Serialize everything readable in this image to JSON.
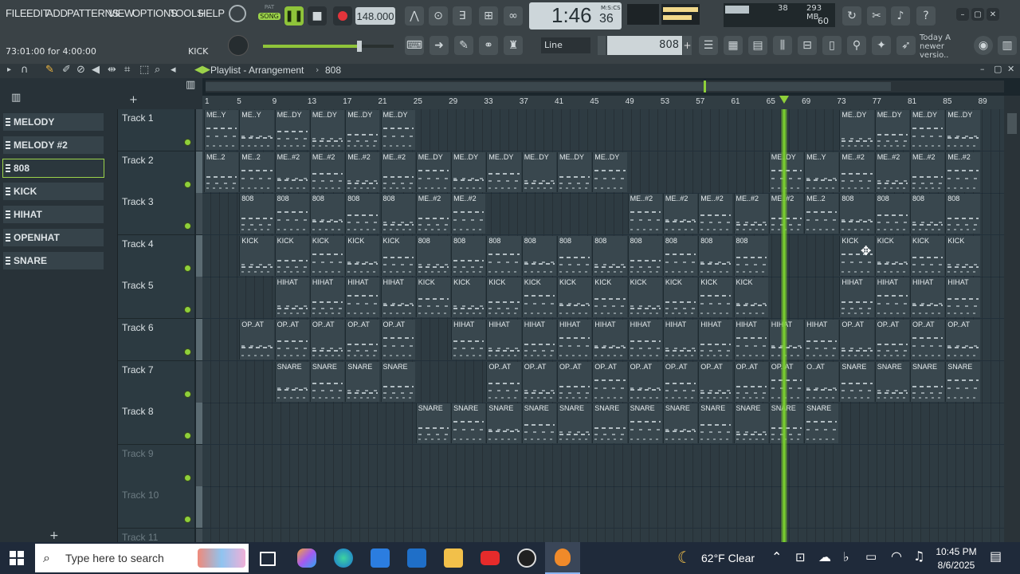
{
  "menu": [
    "FILE",
    "EDIT",
    "ADD",
    "PATTERNS",
    "VIEW",
    "OPTIONS",
    "TOOLS",
    "HELP"
  ],
  "transport": {
    "mode_pat": "PAT",
    "mode_song": "SONG",
    "tempo": "148.000",
    "time_main": "1:46",
    "time_sub": "36",
    "time_label": "M:S:CS"
  },
  "perf": {
    "cpu_num": "38",
    "ram": "293 MB",
    "poly": "60"
  },
  "hint_text": "73:01:00 for 4:00:00",
  "hint_channel": "KICK",
  "snap_mode": "Line",
  "pattern_name": "808",
  "news": {
    "line1": "Today  A",
    "line2": "newer versio.."
  },
  "playlist": {
    "title": "Playlist - Arrangement",
    "current_pattern": "808"
  },
  "patterns": [
    "MELODY",
    "MELODY #2",
    "808",
    "KICK",
    "HIHAT",
    "OPENHAT",
    "SNARE"
  ],
  "selected_pattern_index": 2,
  "tracks": [
    "Track 1",
    "Track 2",
    "Track 3",
    "Track 4",
    "Track 5",
    "Track 6",
    "Track 7",
    "Track 8",
    "Track 9",
    "Track 10",
    "Track 11"
  ],
  "ruler_bars": [
    "1",
    "5",
    "9",
    "13",
    "17",
    "21",
    "25",
    "29",
    "33",
    "37",
    "41",
    "45",
    "49",
    "53",
    "57",
    "61",
    "65",
    "69",
    "73",
    "77",
    "81",
    "85",
    "89"
  ],
  "clip_rows": [
    {
      "track": 1,
      "groups": [
        {
          "label": "ME..Y",
          "start": 0,
          "count": 2
        },
        {
          "label": "ME..DY",
          "start": 2,
          "count": 4
        },
        {
          "label": "ME..DY",
          "start": 18,
          "count": 4
        }
      ]
    },
    {
      "track": 2,
      "groups": [
        {
          "label": "ME..2",
          "start": 0,
          "count": 2
        },
        {
          "label": "ME..#2",
          "start": 2,
          "count": 4
        },
        {
          "label": "ME..DY",
          "start": 6,
          "count": 6
        },
        {
          "label": "ME..DY",
          "start": 16,
          "count": 1
        },
        {
          "label": "ME..Y",
          "start": 17,
          "count": 1
        },
        {
          "label": "ME..#2",
          "start": 18,
          "count": 4
        }
      ]
    },
    {
      "track": 3,
      "groups": [
        {
          "label": "808",
          "start": 1,
          "count": 5
        },
        {
          "label": "ME..#2",
          "start": 6,
          "count": 2
        },
        {
          "label": "ME..#2",
          "start": 12,
          "count": 5
        },
        {
          "label": "ME..2",
          "start": 17,
          "count": 1
        },
        {
          "label": "808",
          "start": 18,
          "count": 4
        }
      ]
    },
    {
      "track": 4,
      "groups": [
        {
          "label": "KICK",
          "start": 1,
          "count": 5
        },
        {
          "label": "808",
          "start": 6,
          "count": 10
        },
        {
          "label": "KICK",
          "start": 18,
          "count": 4
        }
      ]
    },
    {
      "track": 5,
      "groups": [
        {
          "label": "HIHAT",
          "start": 2,
          "count": 4
        },
        {
          "label": "KICK",
          "start": 6,
          "count": 10
        },
        {
          "label": "HIHAT",
          "start": 18,
          "count": 4
        }
      ]
    },
    {
      "track": 6,
      "groups": [
        {
          "label": "OP..AT",
          "start": 1,
          "count": 5
        },
        {
          "label": "HIHAT",
          "start": 7,
          "count": 11
        },
        {
          "label": "OP..AT",
          "start": 18,
          "count": 4
        }
      ]
    },
    {
      "track": 7,
      "groups": [
        {
          "label": "SNARE",
          "start": 2,
          "count": 4
        },
        {
          "label": "OP..AT",
          "start": 8,
          "count": 9
        },
        {
          "label": "O..AT",
          "start": 17,
          "count": 1
        },
        {
          "label": "SNARE",
          "start": 18,
          "count": 4
        }
      ]
    },
    {
      "track": 8,
      "groups": [
        {
          "label": "SNARE",
          "start": 6,
          "count": 12
        }
      ]
    }
  ],
  "taskbar": {
    "search_placeholder": "Type here to search",
    "weather": "62°F  Clear",
    "time": "10:45 PM",
    "date": "8/6/2025"
  },
  "colors": {
    "accent_green": "#7bd22e",
    "clip_bg": "#39474e",
    "grid_bg": "#2e3b42"
  }
}
